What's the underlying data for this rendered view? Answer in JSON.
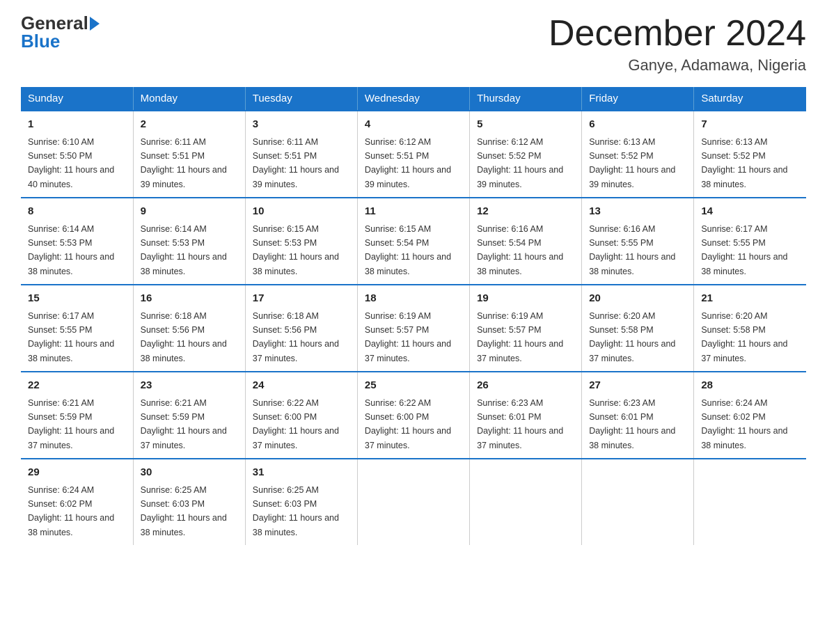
{
  "logo": {
    "general": "General",
    "blue": "Blue"
  },
  "title": "December 2024",
  "subtitle": "Ganye, Adamawa, Nigeria",
  "headers": [
    "Sunday",
    "Monday",
    "Tuesday",
    "Wednesday",
    "Thursday",
    "Friday",
    "Saturday"
  ],
  "weeks": [
    [
      {
        "day": "1",
        "sunrise": "6:10 AM",
        "sunset": "5:50 PM",
        "daylight": "11 hours and 40 minutes."
      },
      {
        "day": "2",
        "sunrise": "6:11 AM",
        "sunset": "5:51 PM",
        "daylight": "11 hours and 39 minutes."
      },
      {
        "day": "3",
        "sunrise": "6:11 AM",
        "sunset": "5:51 PM",
        "daylight": "11 hours and 39 minutes."
      },
      {
        "day": "4",
        "sunrise": "6:12 AM",
        "sunset": "5:51 PM",
        "daylight": "11 hours and 39 minutes."
      },
      {
        "day": "5",
        "sunrise": "6:12 AM",
        "sunset": "5:52 PM",
        "daylight": "11 hours and 39 minutes."
      },
      {
        "day": "6",
        "sunrise": "6:13 AM",
        "sunset": "5:52 PM",
        "daylight": "11 hours and 39 minutes."
      },
      {
        "day": "7",
        "sunrise": "6:13 AM",
        "sunset": "5:52 PM",
        "daylight": "11 hours and 38 minutes."
      }
    ],
    [
      {
        "day": "8",
        "sunrise": "6:14 AM",
        "sunset": "5:53 PM",
        "daylight": "11 hours and 38 minutes."
      },
      {
        "day": "9",
        "sunrise": "6:14 AM",
        "sunset": "5:53 PM",
        "daylight": "11 hours and 38 minutes."
      },
      {
        "day": "10",
        "sunrise": "6:15 AM",
        "sunset": "5:53 PM",
        "daylight": "11 hours and 38 minutes."
      },
      {
        "day": "11",
        "sunrise": "6:15 AM",
        "sunset": "5:54 PM",
        "daylight": "11 hours and 38 minutes."
      },
      {
        "day": "12",
        "sunrise": "6:16 AM",
        "sunset": "5:54 PM",
        "daylight": "11 hours and 38 minutes."
      },
      {
        "day": "13",
        "sunrise": "6:16 AM",
        "sunset": "5:55 PM",
        "daylight": "11 hours and 38 minutes."
      },
      {
        "day": "14",
        "sunrise": "6:17 AM",
        "sunset": "5:55 PM",
        "daylight": "11 hours and 38 minutes."
      }
    ],
    [
      {
        "day": "15",
        "sunrise": "6:17 AM",
        "sunset": "5:55 PM",
        "daylight": "11 hours and 38 minutes."
      },
      {
        "day": "16",
        "sunrise": "6:18 AM",
        "sunset": "5:56 PM",
        "daylight": "11 hours and 38 minutes."
      },
      {
        "day": "17",
        "sunrise": "6:18 AM",
        "sunset": "5:56 PM",
        "daylight": "11 hours and 37 minutes."
      },
      {
        "day": "18",
        "sunrise": "6:19 AM",
        "sunset": "5:57 PM",
        "daylight": "11 hours and 37 minutes."
      },
      {
        "day": "19",
        "sunrise": "6:19 AM",
        "sunset": "5:57 PM",
        "daylight": "11 hours and 37 minutes."
      },
      {
        "day": "20",
        "sunrise": "6:20 AM",
        "sunset": "5:58 PM",
        "daylight": "11 hours and 37 minutes."
      },
      {
        "day": "21",
        "sunrise": "6:20 AM",
        "sunset": "5:58 PM",
        "daylight": "11 hours and 37 minutes."
      }
    ],
    [
      {
        "day": "22",
        "sunrise": "6:21 AM",
        "sunset": "5:59 PM",
        "daylight": "11 hours and 37 minutes."
      },
      {
        "day": "23",
        "sunrise": "6:21 AM",
        "sunset": "5:59 PM",
        "daylight": "11 hours and 37 minutes."
      },
      {
        "day": "24",
        "sunrise": "6:22 AM",
        "sunset": "6:00 PM",
        "daylight": "11 hours and 37 minutes."
      },
      {
        "day": "25",
        "sunrise": "6:22 AM",
        "sunset": "6:00 PM",
        "daylight": "11 hours and 37 minutes."
      },
      {
        "day": "26",
        "sunrise": "6:23 AM",
        "sunset": "6:01 PM",
        "daylight": "11 hours and 37 minutes."
      },
      {
        "day": "27",
        "sunrise": "6:23 AM",
        "sunset": "6:01 PM",
        "daylight": "11 hours and 38 minutes."
      },
      {
        "day": "28",
        "sunrise": "6:24 AM",
        "sunset": "6:02 PM",
        "daylight": "11 hours and 38 minutes."
      }
    ],
    [
      {
        "day": "29",
        "sunrise": "6:24 AM",
        "sunset": "6:02 PM",
        "daylight": "11 hours and 38 minutes."
      },
      {
        "day": "30",
        "sunrise": "6:25 AM",
        "sunset": "6:03 PM",
        "daylight": "11 hours and 38 minutes."
      },
      {
        "day": "31",
        "sunrise": "6:25 AM",
        "sunset": "6:03 PM",
        "daylight": "11 hours and 38 minutes."
      },
      {
        "day": "",
        "sunrise": "",
        "sunset": "",
        "daylight": ""
      },
      {
        "day": "",
        "sunrise": "",
        "sunset": "",
        "daylight": ""
      },
      {
        "day": "",
        "sunrise": "",
        "sunset": "",
        "daylight": ""
      },
      {
        "day": "",
        "sunrise": "",
        "sunset": "",
        "daylight": ""
      }
    ]
  ],
  "labels": {
    "sunrise": "Sunrise:",
    "sunset": "Sunset:",
    "daylight": "Daylight:"
  }
}
